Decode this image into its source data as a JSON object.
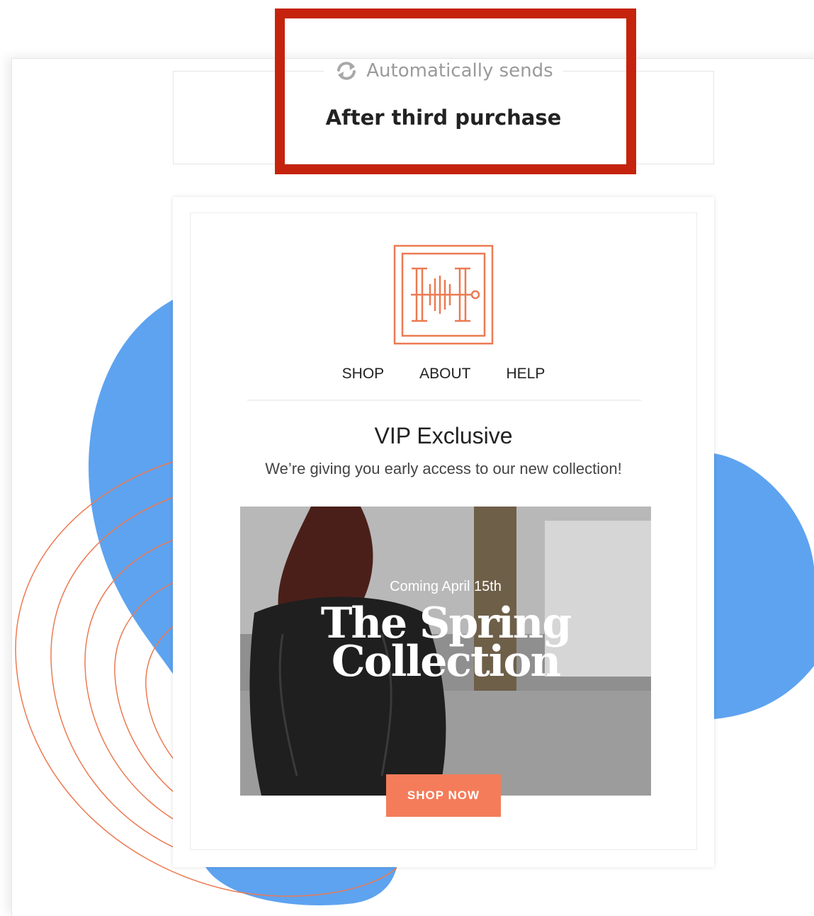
{
  "trigger": {
    "label": "Automatically sends",
    "icon": "refresh-icon",
    "value": "After third purchase"
  },
  "email": {
    "logo_icon": "brand-logo",
    "nav": [
      "SHOP",
      "ABOUT",
      "HELP"
    ],
    "headline": "VIP Exclusive",
    "subheadline": "We’re giving you early access to our new collection!",
    "hero": {
      "subtitle": "Coming April 15th",
      "title_line1": "The Spring",
      "title_line2": "Collection"
    },
    "cta_label": "SHOP NOW"
  },
  "colors": {
    "highlight": "#c5230d",
    "accent": "#f47c5a",
    "blob": "#5ea3f0"
  }
}
